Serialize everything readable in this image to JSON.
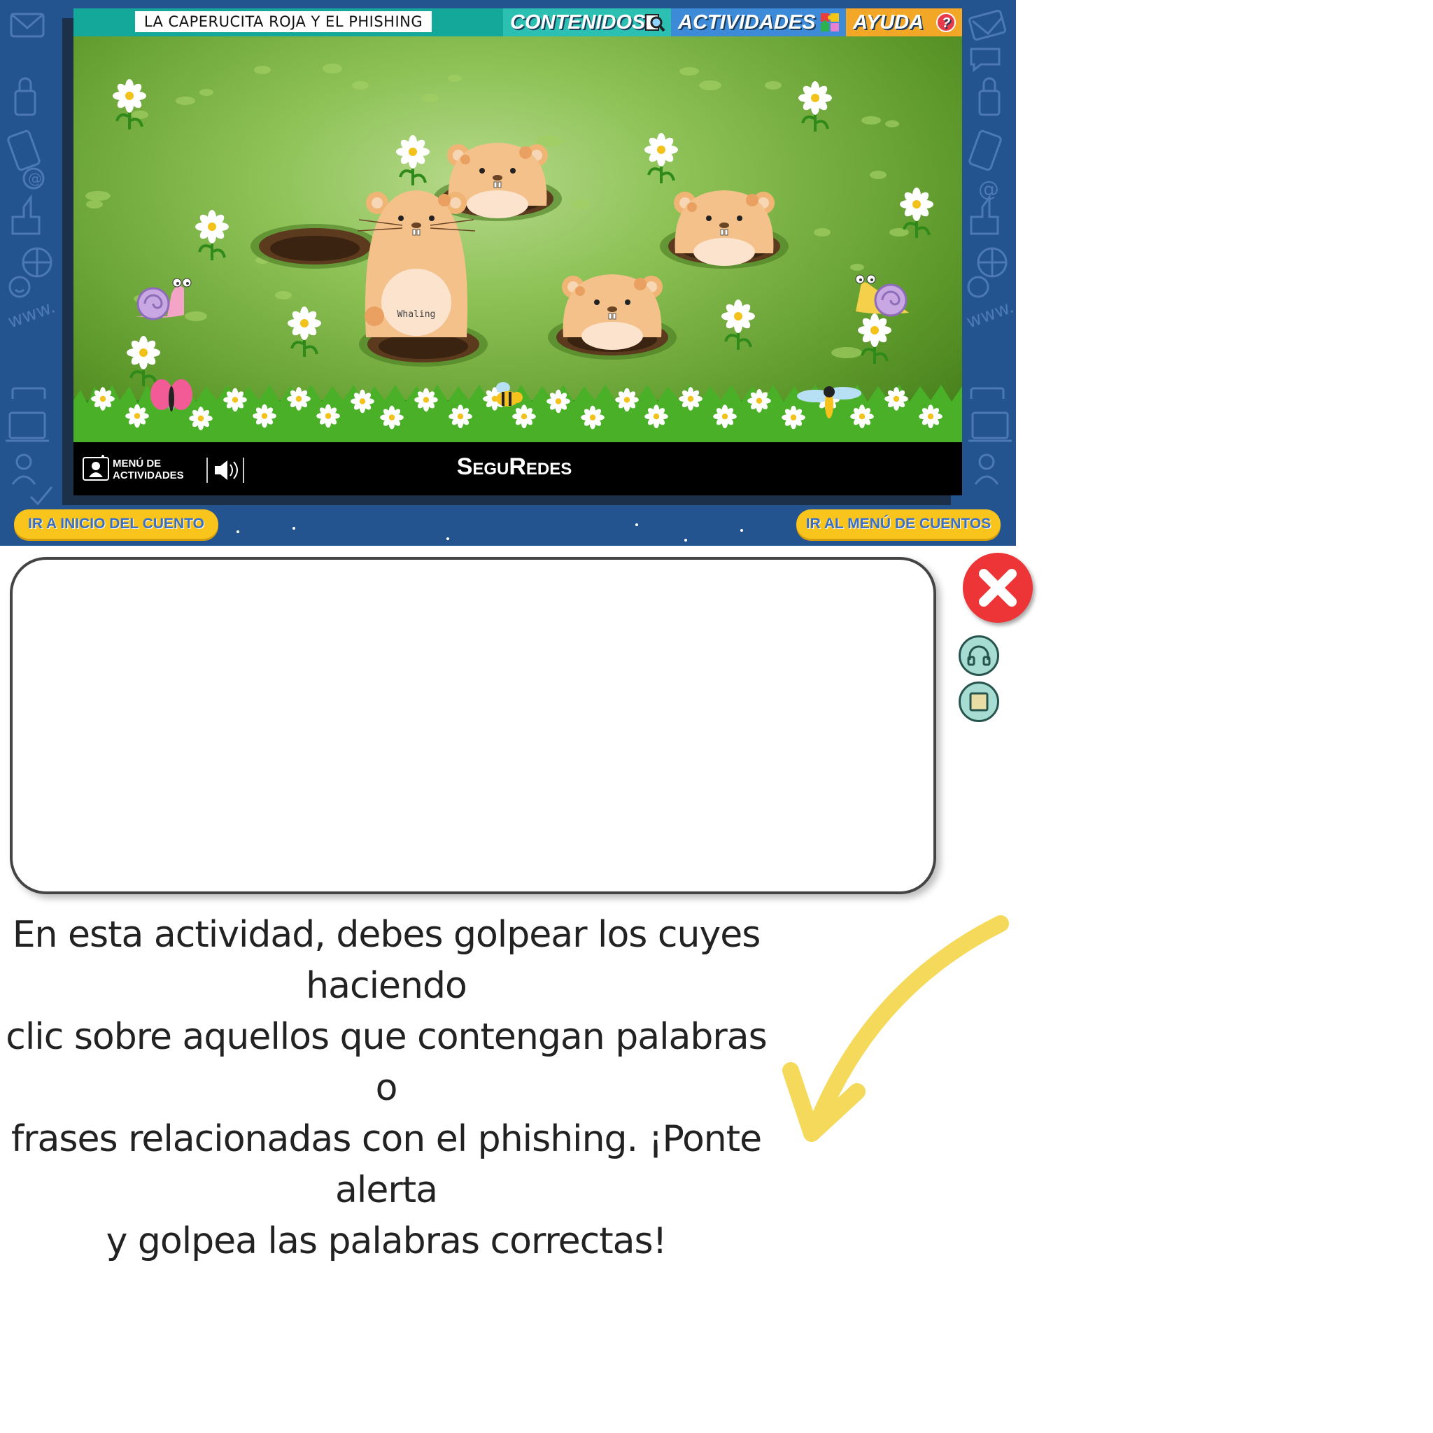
{
  "window": {
    "title": "LA CAPERUCITA ROJA Y EL PHISHING",
    "tabs": [
      {
        "label": "CONTENIDOS",
        "icon": "magnifier-icon"
      },
      {
        "label": "ACTIVIDADES",
        "icon": "puzzle-icon"
      },
      {
        "label": "AYUDA",
        "icon": "question-icon"
      }
    ]
  },
  "game": {
    "active_word": "Whaling"
  },
  "bottom_bar": {
    "menu_label_line1": "MENÚ DE",
    "menu_label_line2": "ACTIVIDADES",
    "brand": "SeguRedes"
  },
  "nav": {
    "start_story": "IR A INICIO DEL CUENTO",
    "stories_menu": "IR AL MENÚ DE CUENTOS"
  },
  "instructions": {
    "line1": "En esta actividad, debes golpear los cuyes haciendo",
    "line2": "clic sobre aquellos que contengan palabras o",
    "line3": "frases relacionadas con el phishing. ¡Ponte alerta",
    "line4": "y golpea las palabras correctas!"
  },
  "colors": {
    "frame_blue": "#24548f",
    "teal_bar": "#14a89a",
    "pill_yellow": "#f9c51d",
    "close_red": "#ed3437",
    "arrow_yellow": "#f5d95a"
  }
}
